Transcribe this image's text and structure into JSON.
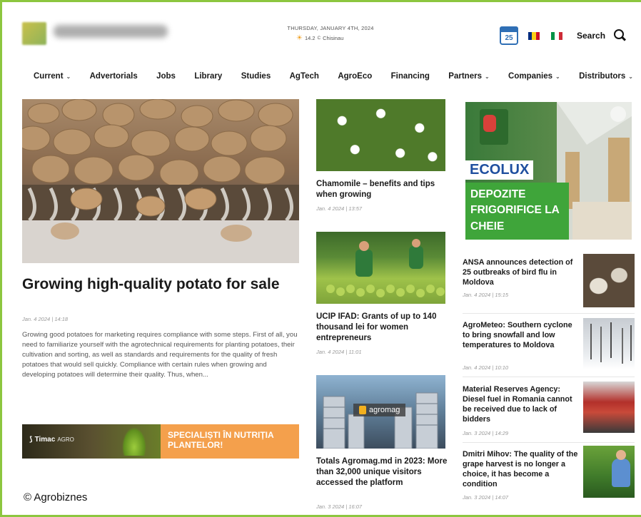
{
  "header": {
    "date": "THURSDAY, JANUARY 4TH, 2024",
    "temperature": "14.2",
    "temperature_unit": "C",
    "city": "Chisinau",
    "calendar_day": "25",
    "search_label": "Search"
  },
  "nav": {
    "items": [
      {
        "label": "Current",
        "dropdown": true
      },
      {
        "label": "Advertorials",
        "dropdown": false
      },
      {
        "label": "Jobs",
        "dropdown": false
      },
      {
        "label": "Library",
        "dropdown": false
      },
      {
        "label": "Studies",
        "dropdown": false
      },
      {
        "label": "AgTech",
        "dropdown": false
      },
      {
        "label": "AgroEco",
        "dropdown": false
      },
      {
        "label": "Financing",
        "dropdown": false
      },
      {
        "label": "Partners",
        "dropdown": true
      },
      {
        "label": "Companies",
        "dropdown": true
      },
      {
        "label": "Distributors",
        "dropdown": true
      }
    ],
    "caret": "⌄"
  },
  "featured": {
    "title": "Growing high-quality potato for sale",
    "date": "Jan. 4 2024 | 14:18",
    "excerpt": "Growing good potatoes for marketing requires compliance with some steps. First of all, you need to familiarize yourself with the agrotechnical requirements for planting potatoes, their cultivation and sorting, as well as standards and requirements for the quality of fresh potatoes that would sell quickly. Compliance with certain rules when growing and developing potatoes will determine their quality. Thus, when..."
  },
  "ad_timac": {
    "brand": "Timac",
    "brand_suffix": "AGRO",
    "slogan": "SPECIALIȘTI ÎN NUTRIȚIA PLANTELOR!"
  },
  "middle_articles": [
    {
      "title": "Chamomile – benefits and tips when growing",
      "date": "Jan. 4 2024 | 13:57"
    },
    {
      "title": "UCIP IFAD: Grants of up to 140 thousand lei for women entrepreneurs",
      "date": "Jan. 4 2024 | 11:01"
    },
    {
      "title": "Totals Agromag.md in 2023: More than 32,000 unique visitors accessed the platform",
      "date": "Jan. 3 2024 | 16:07",
      "badge": "agromag"
    }
  ],
  "ad_ecolux": {
    "brand": "ECOLUX",
    "tagline": "DEPOZITE FRIGORIFICE LA CHEIE"
  },
  "right_articles": [
    {
      "title": "ANSA announces detection of 25 outbreaks of bird flu in Moldova",
      "date": "Jan. 4 2024 | 15:15"
    },
    {
      "title": "AgroMeteo: Southern cyclone to bring snowfall and low temperatures to Moldova",
      "date": "Jan. 4 2024 | 10:10"
    },
    {
      "title": "Material Reserves Agency: Diesel fuel in Romania cannot be received due to lack of bidders",
      "date": "Jan. 3 2024 | 14:29"
    },
    {
      "title": "Dmitri Mihov: The quality of the grape harvest is no longer a choice, it has become a condition",
      "date": "Jan. 3 2024 | 14:07"
    }
  ],
  "copyright": "© Agrobiznes",
  "colors": {
    "frame": "#8cc63f",
    "accent_orange": "#f4a04c",
    "ecolux_green": "#3fa53a",
    "ecolux_blue": "#1f4f9f"
  }
}
